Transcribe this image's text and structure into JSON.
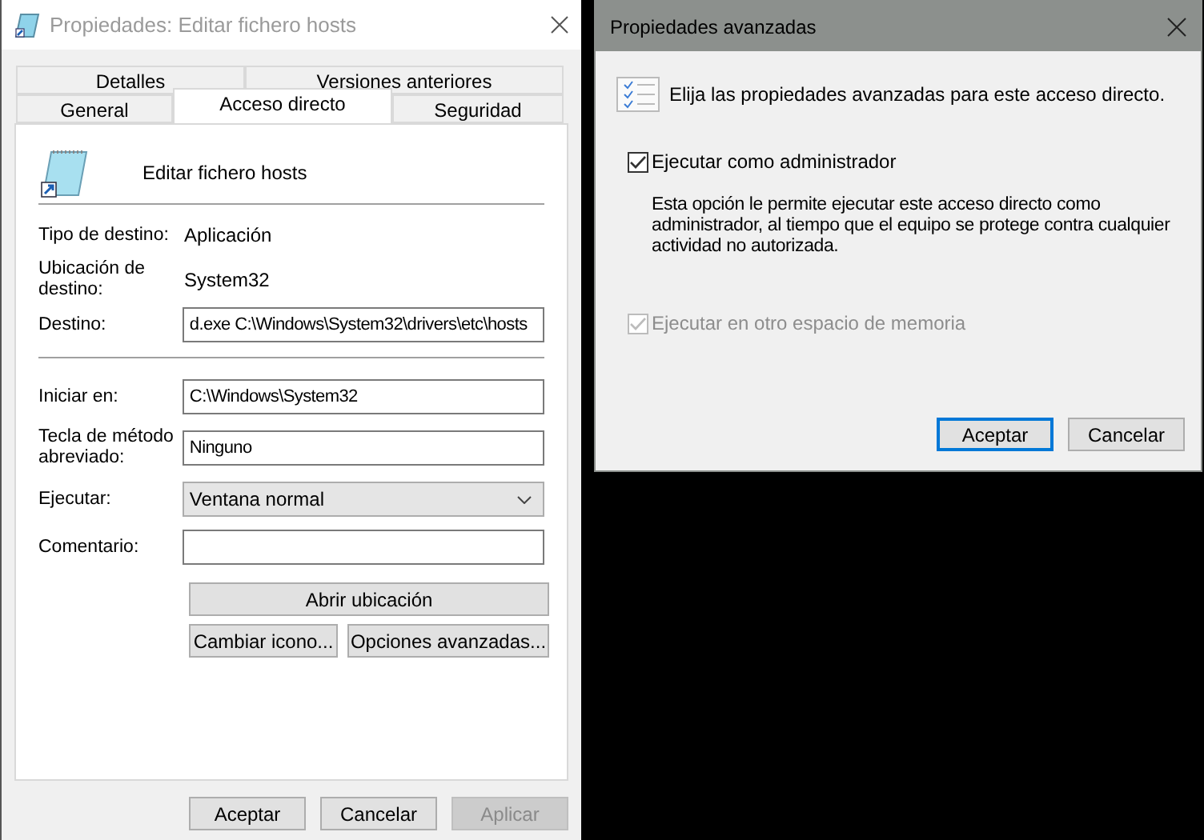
{
  "main_window": {
    "title": "Propiedades: Editar fichero hosts",
    "tab_rows": [
      [
        {
          "label": "Detalles",
          "selected": false
        },
        {
          "label": "Versiones anteriores",
          "selected": false
        }
      ],
      [
        {
          "label": "General",
          "selected": false
        },
        {
          "label": "Acceso directo",
          "selected": true
        },
        {
          "label": "Seguridad",
          "selected": false
        }
      ]
    ],
    "shortcut_name": "Editar fichero hosts",
    "info_rows": [
      {
        "kind": "text",
        "label": "Tipo de destino:",
        "value": "Aplicación"
      },
      {
        "kind": "text",
        "label": "Ubicación de destino:",
        "value": "System32"
      },
      {
        "kind": "field",
        "label": "Destino:",
        "value": "d.exe C:\\Windows\\System32\\drivers\\etc\\hosts"
      }
    ],
    "settings_rows": [
      {
        "kind": "field",
        "label": "Iniciar en:",
        "value": "C:\\Windows\\System32"
      },
      {
        "kind": "field",
        "label": "Tecla de método abreviado:",
        "value": "Ninguno"
      },
      {
        "kind": "select",
        "label": "Ejecutar:",
        "value": "Ventana normal"
      },
      {
        "kind": "field",
        "label": "Comentario:"
      }
    ],
    "open_location_button": "Abrir ubicación",
    "action_buttons": [
      "Cambiar icono...",
      "Opciones avanzadas..."
    ],
    "buttons": [
      {
        "label": "Aceptar",
        "disabled": false
      },
      {
        "label": "Cancelar",
        "disabled": false
      },
      {
        "label": "Aplicar",
        "disabled": true
      }
    ]
  },
  "advanced_dialog": {
    "title": "Propiedades avanzadas",
    "intro": "Elija las propiedades avanzadas para este acceso directo.",
    "options": [
      {
        "label": "Ejecutar como administrador",
        "checked": true,
        "disabled": false,
        "description": "Esta opción le permite ejecutar este acceso directo como administrador, al tiempo que el equipo se protege contra cualquier actividad no autorizada."
      },
      {
        "label": "Ejecutar en otro espacio de memoria",
        "checked": true,
        "disabled": true
      }
    ],
    "buttons": [
      {
        "label": "Aceptar",
        "focused": true
      },
      {
        "label": "Cancelar",
        "focused": false
      }
    ]
  }
}
